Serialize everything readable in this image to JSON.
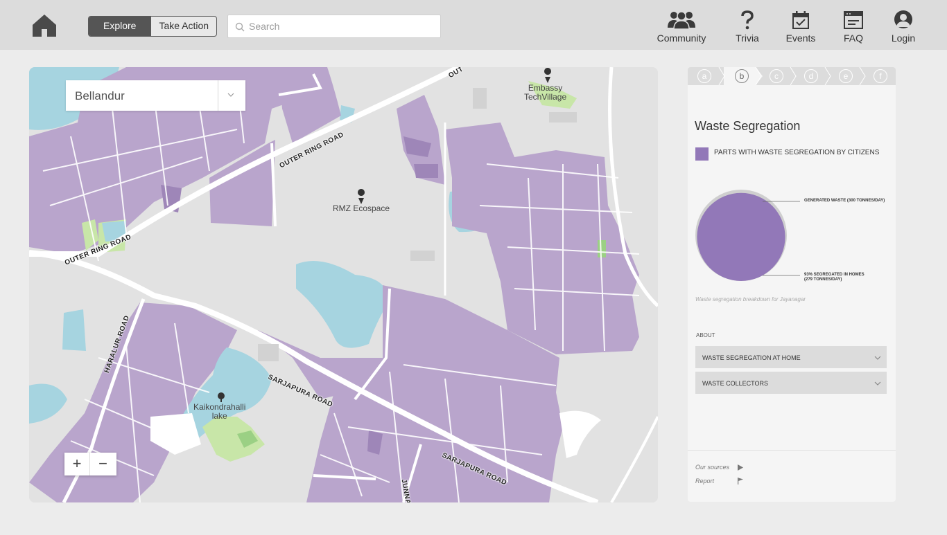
{
  "header": {
    "segmented": {
      "explore_label": "Explore",
      "take_action_label": "Take Action"
    },
    "search": {
      "placeholder": "Search",
      "value": ""
    },
    "nav": {
      "community": "Community",
      "trivia": "Trivia",
      "events": "Events",
      "faq": "FAQ",
      "login": "Login"
    }
  },
  "map": {
    "location_select": {
      "value": "Bellandur"
    },
    "labels": {
      "rmz": "RMZ Ecospace",
      "embassy_line1": "Embassy",
      "embassy_line2": "TechVillage",
      "lake_line1": "Kaikondrahalli",
      "lake_line2": "lake"
    },
    "roads": {
      "orr_top": "OUTER RING ROAD",
      "orr_left": "OUTER RING ROAD",
      "orr_corner": "OUT",
      "haralur": "HARALUR ROAD",
      "sarjapura_1": "SARJAPURA ROAD",
      "sarjapura_2": "SARJAPURA ROAD",
      "junnasandra": "JUNNASA"
    },
    "zoom": {
      "in": "+",
      "out": "−"
    },
    "colors": {
      "ward": "#b9a5cc",
      "water": "#a6d4e0",
      "park": "#c8e6a8",
      "road": "#ffffff",
      "land": "#e2e2e2"
    }
  },
  "panel": {
    "tabs": [
      {
        "label": "a",
        "active": false
      },
      {
        "label": "b",
        "active": true
      },
      {
        "label": "c",
        "active": false
      },
      {
        "label": "d",
        "active": false
      },
      {
        "label": "e",
        "active": false
      },
      {
        "label": "f",
        "active": false
      }
    ],
    "title": "Waste Segregation",
    "legend": {
      "label": "PARTS WITH WASTE SEGREGATION BY CITIZENS",
      "color": "#9278b8"
    },
    "chart": {
      "generated_label": "GENERATED WASTE (300 TONNES/DAY)",
      "segregated_line1": "93% SEGREGATED IN HOMES",
      "segregated_line2": "(279 TONNES/DAY)",
      "generated_tonnes": 300,
      "segregated_tonnes": 279,
      "segregated_percent": 93
    },
    "caption": "Waste segregation breakdown for Jayanagar",
    "about_label": "ABOUT",
    "accordions": [
      {
        "label": "WASTE SEGREGATION AT HOME"
      },
      {
        "label": "WASTE COLLECTORS"
      }
    ],
    "footer": {
      "sources": "Our sources",
      "report": "Report"
    }
  }
}
